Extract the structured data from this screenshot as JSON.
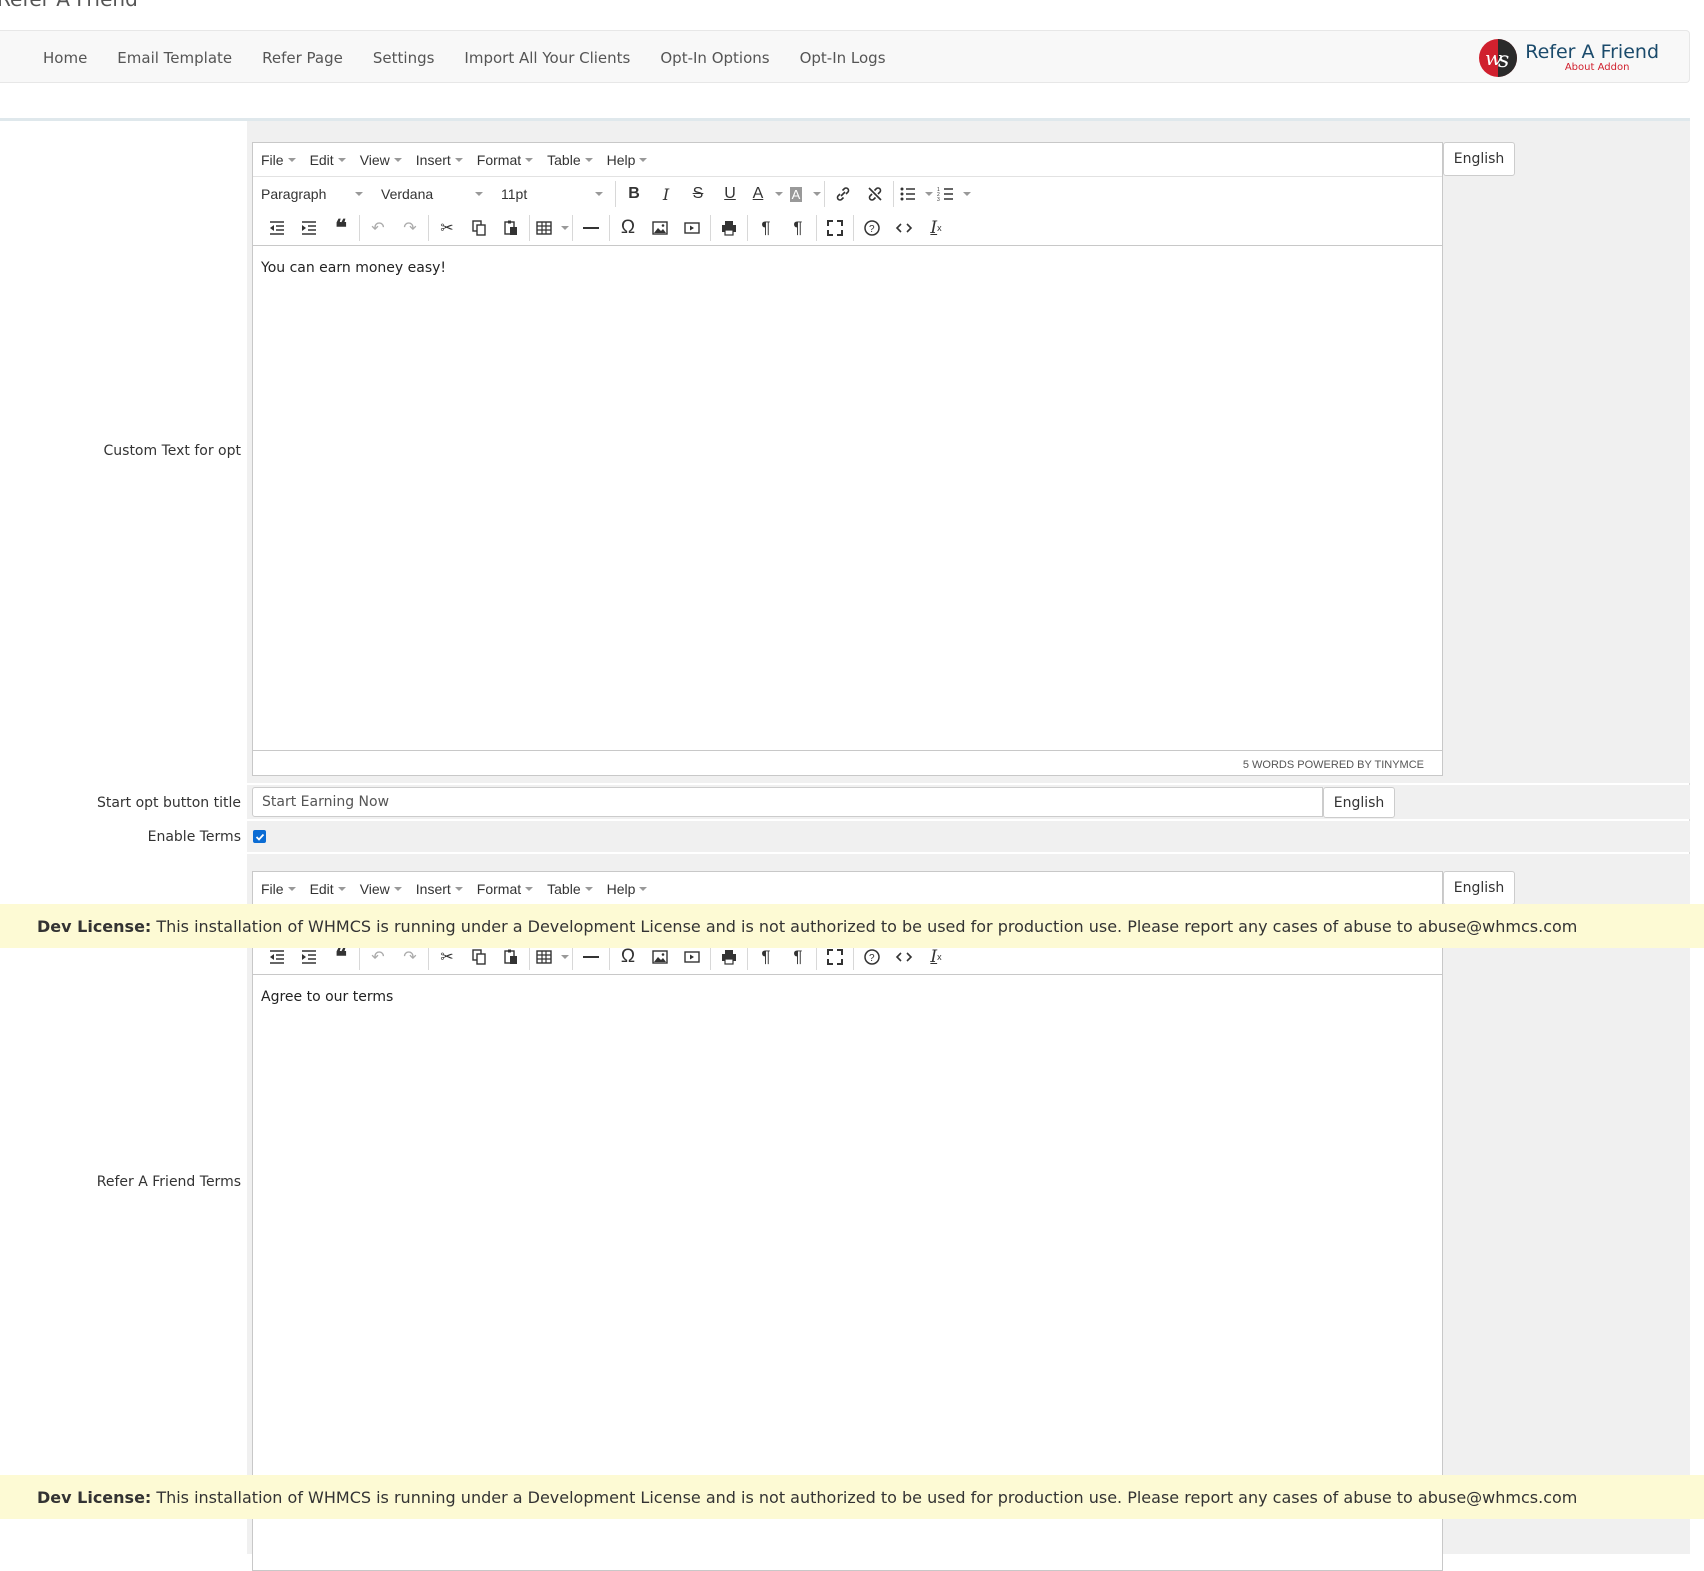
{
  "page": {
    "title": "Refer A Friend"
  },
  "nav": {
    "items": [
      "Home",
      "Email Template",
      "Refer Page",
      "Settings",
      "Import All Your Clients",
      "Opt-In Options",
      "Opt-In Logs"
    ],
    "brand_title": "Refer A Friend",
    "brand_sub": "About Addon"
  },
  "editor_menu": [
    "File",
    "Edit",
    "View",
    "Insert",
    "Format",
    "Table",
    "Help"
  ],
  "editor_toolbar": {
    "block_format": "Paragraph",
    "font_family": "Verdana",
    "font_size": "11pt"
  },
  "fields": {
    "custom_text": {
      "label": "Custom Text for opt",
      "content": "You can earn money easy!",
      "status": "5 WORDS POWERED BY TINYMCE",
      "language": "English"
    },
    "start_button": {
      "label": "Start opt button title",
      "value": "Start Earning Now",
      "language": "English"
    },
    "enable_terms": {
      "label": "Enable Terms",
      "checked": true
    },
    "terms": {
      "label": "Refer A Friend Terms",
      "content": "Agree to our terms",
      "language": "English"
    }
  },
  "banner": {
    "bold": "Dev License:",
    "text": "This installation of WHMCS is running under a Development License and is not authorized to be used for production use. Please report any cases of abuse to abuse@whmcs.com"
  },
  "colors": {
    "accent": "#0b6cd4",
    "banner_bg": "#fdfad4",
    "brand_red": "#d0202e",
    "brand_blue": "#1a4a6b"
  }
}
